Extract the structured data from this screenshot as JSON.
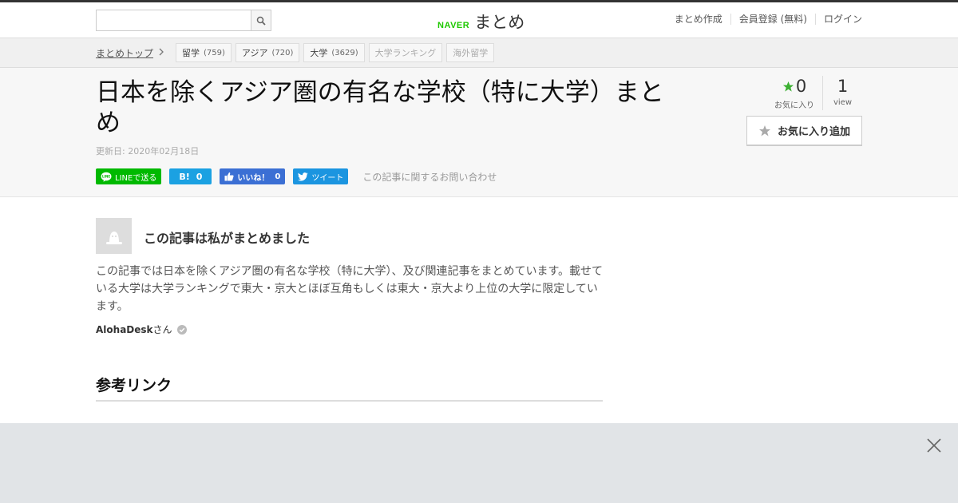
{
  "header": {
    "search_placeholder": "",
    "logo_naver": "NAVER",
    "logo_matome": "まとめ",
    "links": [
      "まとめ作成",
      "会員登録 (無料)",
      "ログイン"
    ]
  },
  "breadcrumb": {
    "top": "まとめトップ",
    "tags": [
      {
        "label": "留学",
        "count": "(759)"
      },
      {
        "label": "アジア",
        "count": "(720)"
      },
      {
        "label": "大学",
        "count": "(3629)"
      },
      {
        "label": "大学ランキング",
        "count": ""
      },
      {
        "label": "海外留学",
        "count": ""
      }
    ]
  },
  "article": {
    "title": "日本を除くアジア圏の有名な学校（特に大学）まとめ",
    "updated": "更新日: 2020年02月18日",
    "social": {
      "line": "LINEで送る",
      "hatena_count": "0",
      "like_label": "いいね！",
      "like_count": "0",
      "tweet": "ツイート"
    },
    "inquiry": "この記事に関するお問い合わせ",
    "stats": {
      "favorites": "0",
      "favorites_label": "お気に入り",
      "views": "1",
      "views_label": "view"
    },
    "fav_button": "お気に入り追加",
    "author_heading": "この記事は私がまとめました",
    "description": "この記事では日本を除くアジア圏の有名な学校（特に大学）、及び関連記事をまとめています。載せている大学は大学ランキングで東大・京大とほぼ互角もしくは東大・京大より上位の大学に限定しています。",
    "author_name": "AlohaDesk",
    "author_suffix": "さん",
    "section_title": "参考リンク"
  },
  "colors": {
    "naver_green": "#1ec800",
    "line_green": "#00b900",
    "hatena_blue": "#1ba1e2",
    "facebook_blue": "#3b6fd4",
    "twitter_blue": "#1b95e0",
    "star_green": "#3cb032"
  },
  "icons": [
    "search-icon",
    "chevron-right-icon",
    "line-icon",
    "hatena-icon",
    "thumbs-up-icon",
    "twitter-bird-icon",
    "star-icon",
    "user-avatar-icon",
    "verified-check-icon",
    "close-icon"
  ]
}
